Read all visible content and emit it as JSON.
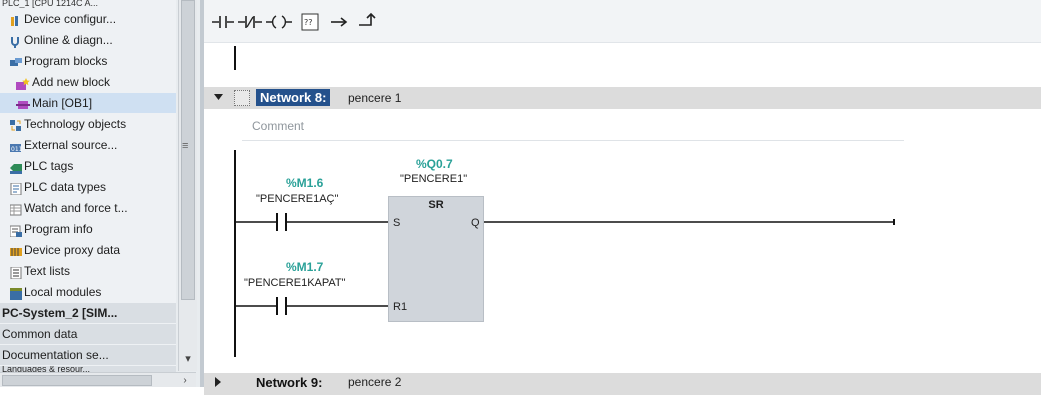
{
  "tree": {
    "clipped_top": "PLC_1 [CPU 1214C A...",
    "items": [
      {
        "label": "Device configur...",
        "icon": "device-config-icon"
      },
      {
        "label": "Online & diagn...",
        "icon": "online-diag-icon"
      },
      {
        "label": "Program blocks",
        "icon": "program-blocks-icon"
      },
      {
        "label": "Add new block",
        "icon": "add-block-icon"
      },
      {
        "label": "Main [OB1]",
        "icon": "ob-block-icon"
      },
      {
        "label": "Technology objects",
        "icon": "technology-icon"
      },
      {
        "label": "External source...",
        "icon": "external-source-icon"
      },
      {
        "label": "PLC tags",
        "icon": "plc-tags-icon"
      },
      {
        "label": "PLC data types",
        "icon": "data-types-icon"
      },
      {
        "label": "Watch and force t...",
        "icon": "watch-table-icon"
      },
      {
        "label": "Program info",
        "icon": "program-info-icon"
      },
      {
        "label": "Device proxy data",
        "icon": "proxy-data-icon"
      },
      {
        "label": "Text lists",
        "icon": "text-lists-icon"
      },
      {
        "label": "Local modules",
        "icon": "local-modules-icon"
      }
    ],
    "sections": [
      "PC-System_2 [SIM...",
      "Common data",
      "Documentation se..."
    ],
    "clipped_bottom": "Languages & resour..."
  },
  "toolbar": {
    "buttons": [
      "no-contact-icon",
      "nc-contact-icon",
      "coil-icon",
      "empty-box-icon",
      "open-branch-icon",
      "close-branch-icon"
    ],
    "box_glyph": "??"
  },
  "networks": [
    {
      "title": "Network 8:",
      "name": "pencere 1"
    },
    {
      "title": "Network 9:",
      "name": "pencere 2"
    }
  ],
  "comment_placeholder": "Comment",
  "ladder": {
    "contact1": {
      "address": "%M1.6",
      "name": "\"PENCERE1AÇ\""
    },
    "contact2": {
      "address": "%M1.7",
      "name": "\"PENCERE1KAPAT\""
    },
    "block": {
      "address": "%Q0.7",
      "name": "\"PENCERE1\"",
      "type": "SR",
      "pin_s": "S",
      "pin_q": "Q",
      "pin_r1": "R1"
    }
  },
  "colors": {
    "accent": "#24518c",
    "tag": "#2aa198",
    "netbar": "#dcdcdc"
  }
}
